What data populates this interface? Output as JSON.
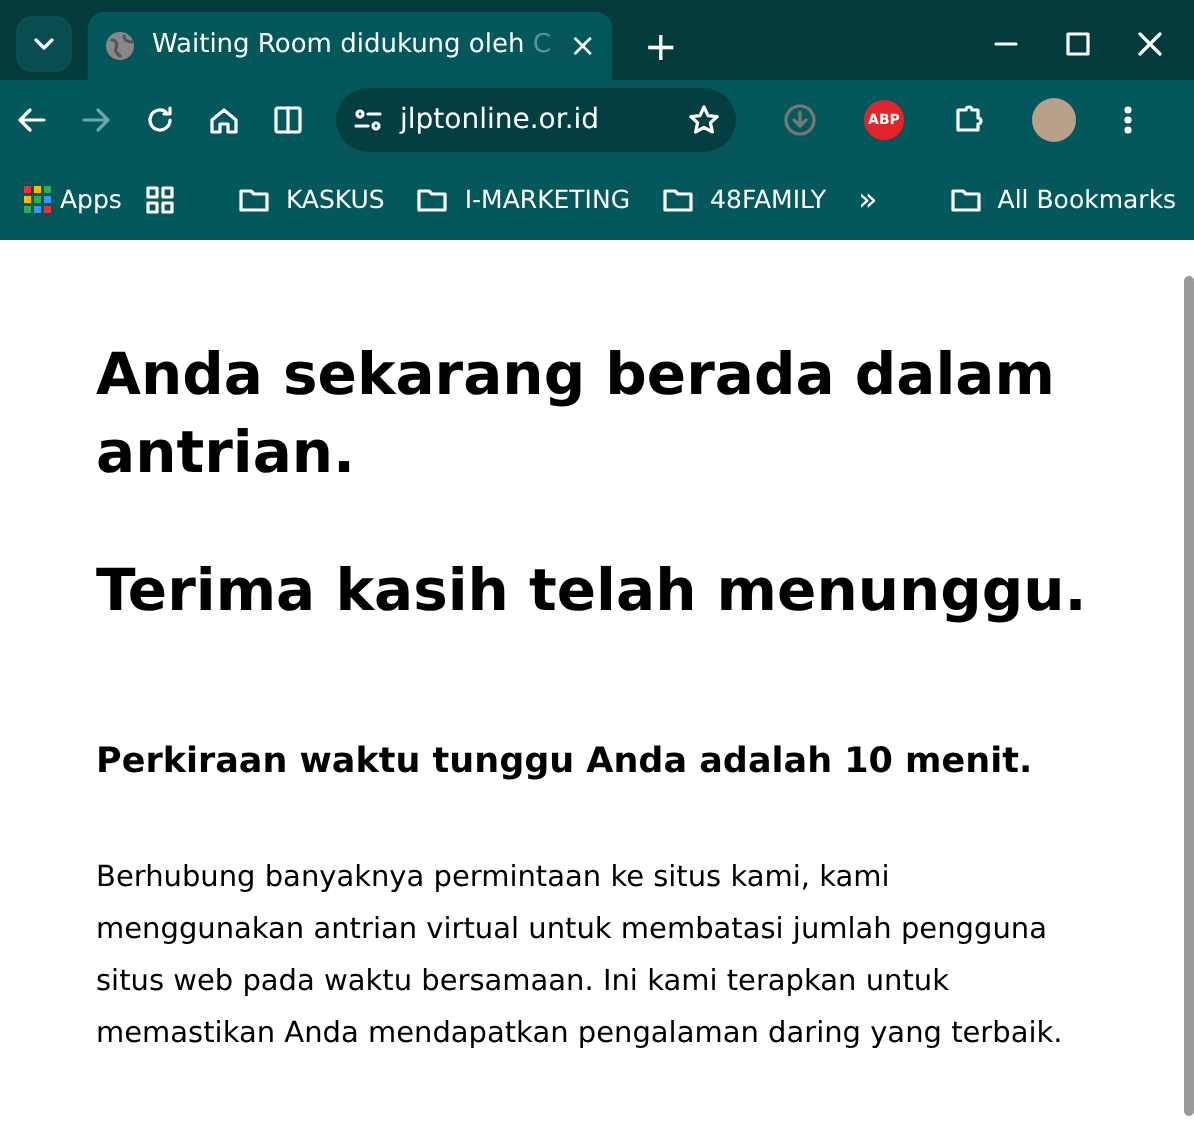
{
  "tab": {
    "title": "Waiting Room didukung oleh C",
    "close": "×"
  },
  "new_tab": "+",
  "address": {
    "url": "jlptonline.or.id"
  },
  "extensions": {
    "abp": "ABP"
  },
  "bookmarks": [
    {
      "kind": "apps",
      "label": "Apps"
    },
    {
      "kind": "grid"
    },
    {
      "kind": "folder",
      "label": "KASKUS"
    },
    {
      "kind": "folder",
      "label": "I-MARKETING"
    },
    {
      "kind": "folder",
      "label": "48FAMILY"
    },
    {
      "kind": "more",
      "label": "»"
    },
    {
      "kind": "folder",
      "label": "All Bookmarks"
    }
  ],
  "page": {
    "headings": [
      "Anda sekarang berada dalam antrian.",
      "Terima kasih telah menunggu."
    ],
    "estimate": "Perkiraan waktu tunggu Anda adalah 10 menit.",
    "body": "Berhubung banyaknya permintaan ke situs kami, kami menggunakan antrian virtual untuk membatasi jumlah pengguna situs web pada waktu bersamaan. Ini kami terapkan untuk memastikan Anda mendapatkan pengalaman daring yang terbaik."
  }
}
